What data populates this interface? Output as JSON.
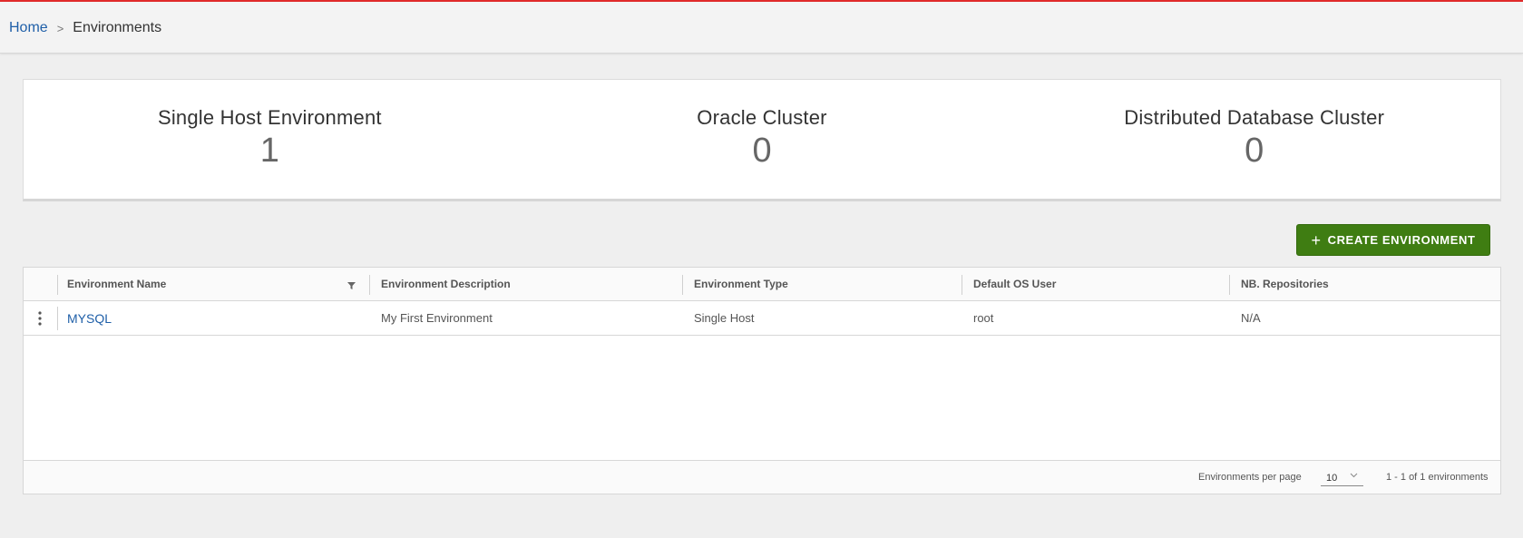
{
  "breadcrumb": {
    "home": "Home",
    "separator": ">",
    "current": "Environments"
  },
  "summary": [
    {
      "label": "Single Host Environment",
      "value": "1"
    },
    {
      "label": "Oracle Cluster",
      "value": "0"
    },
    {
      "label": "Distributed Database Cluster",
      "value": "0"
    }
  ],
  "toolbar": {
    "create_label": "CREATE ENVIRONMENT",
    "create_icon": "plus-icon"
  },
  "table": {
    "columns": [
      "Environment Name",
      "Environment Description",
      "Environment Type",
      "Default OS User",
      "NB. Repositories"
    ],
    "rows": [
      {
        "name": "MYSQL",
        "description": "My First Environment",
        "type": "Single Host",
        "os_user": "root",
        "repositories": "N/A"
      }
    ]
  },
  "pagination": {
    "per_page_label": "Environments per page",
    "per_page_value": "10",
    "range_text": "1 - 1 of 1 environments"
  },
  "colors": {
    "accent_green": "#3f7d12",
    "link_blue": "#1f5fa8",
    "top_border_red": "#e02a2a"
  }
}
